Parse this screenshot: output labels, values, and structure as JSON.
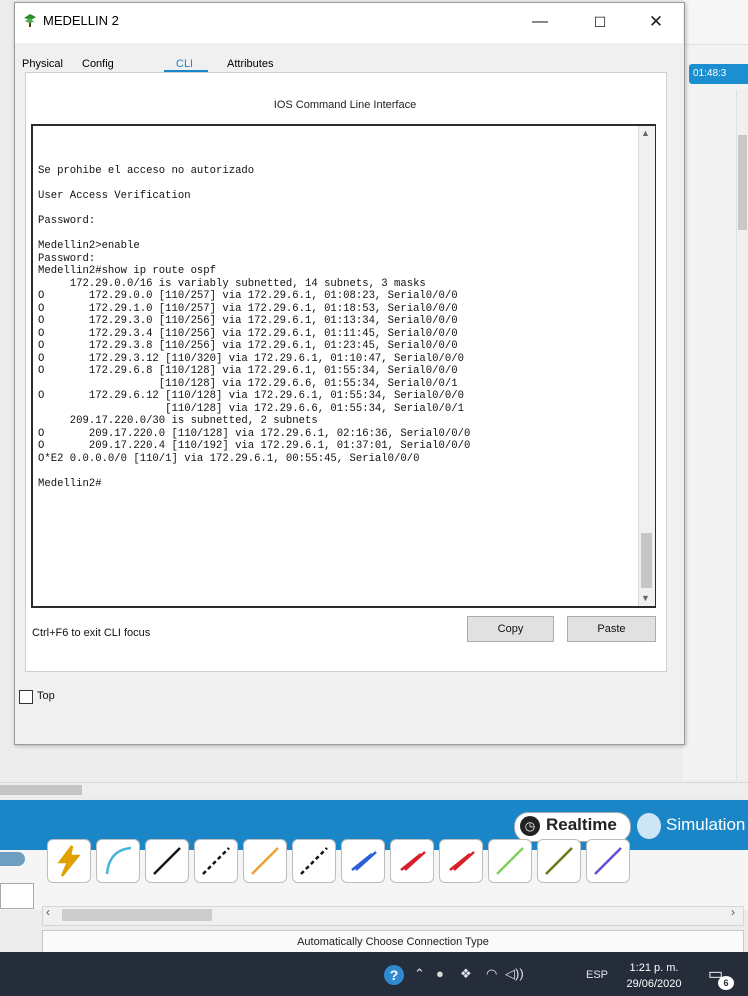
{
  "window": {
    "title": "MEDELLIN 2",
    "minimize": "—",
    "maximize": "☐",
    "close": "✕"
  },
  "tabs": [
    {
      "label": "Physical"
    },
    {
      "label": "Config"
    },
    {
      "label": "CLI",
      "active": true
    },
    {
      "label": "Attributes"
    }
  ],
  "cli": {
    "header": "IOS Command Line Interface",
    "lines": [
      "Se prohibe el acceso no autorizado",
      "",
      "User Access Verification",
      "",
      "Password:",
      "",
      "Medellin2>enable",
      "Password:",
      "Medellin2#show ip route ospf",
      "     172.29.0.0/16 is variably subnetted, 14 subnets, 3 masks",
      "O       172.29.0.0 [110/257] via 172.29.6.1, 01:08:23, Serial0/0/0",
      "O       172.29.1.0 [110/257] via 172.29.6.1, 01:18:53, Serial0/0/0",
      "O       172.29.3.0 [110/256] via 172.29.6.1, 01:13:34, Serial0/0/0",
      "O       172.29.3.4 [110/256] via 172.29.6.1, 01:11:45, Serial0/0/0",
      "O       172.29.3.8 [110/256] via 172.29.6.1, 01:23:45, Serial0/0/0",
      "O       172.29.3.12 [110/320] via 172.29.6.1, 01:10:47, Serial0/0/0",
      "O       172.29.6.8 [110/128] via 172.29.6.1, 01:55:34, Serial0/0/0",
      "                   [110/128] via 172.29.6.6, 01:55:34, Serial0/0/1",
      "O       172.29.6.12 [110/128] via 172.29.6.1, 01:55:34, Serial0/0/0",
      "                    [110/128] via 172.29.6.6, 01:55:34, Serial0/0/1",
      "     209.17.220.0/30 is subnetted, 2 subnets",
      "O       209.17.220.0 [110/128] via 172.29.6.1, 02:16:36, Serial0/0/0",
      "O       209.17.220.4 [110/192] via 172.29.6.1, 01:37:01, Serial0/0/0",
      "O*E2 0.0.0.0/0 [110/1] via 172.29.6.1, 00:55:45, Serial0/0/0",
      "",
      "Medellin2#"
    ],
    "focus_hint": "Ctrl+F6 to exit CLI focus",
    "copy_label": "Copy",
    "paste_label": "Paste"
  },
  "top_checkbox_label": "Top",
  "workspace": {
    "timer": "01:48:3",
    "realtime_label": "Realtime",
    "simulation_label": "Simulation",
    "connection_type": "Automatically Choose Connection Type"
  },
  "taskbar": {
    "language": "ESP",
    "time": "1:21 p. m.",
    "date": "29/06/2020",
    "notification_count": "6"
  },
  "tools": [
    {
      "icon": "lightning-auto-connection-icon",
      "color": "#e0a000"
    },
    {
      "icon": "console-cable-icon",
      "color": "#4ab3d8"
    },
    {
      "icon": "straight-through-cable-icon",
      "color": "#111111"
    },
    {
      "icon": "crossover-cable-icon",
      "color": "#111111"
    },
    {
      "icon": "fiber-cable-icon",
      "color": "#f0a030"
    },
    {
      "icon": "phone-cable-icon",
      "color": "#111111"
    },
    {
      "icon": "coaxial-cable-icon",
      "color": "#2a5fd8"
    },
    {
      "icon": "serial-dce-cable-icon",
      "color": "#d8202a"
    },
    {
      "icon": "serial-dte-cable-icon",
      "color": "#d8202a"
    },
    {
      "icon": "octal-cable-icon",
      "color": "#7fd060"
    },
    {
      "icon": "iot-custom-cable-icon",
      "color": "#6b7a18"
    },
    {
      "icon": "usb-cable-icon",
      "color": "#6a4bd8"
    }
  ]
}
